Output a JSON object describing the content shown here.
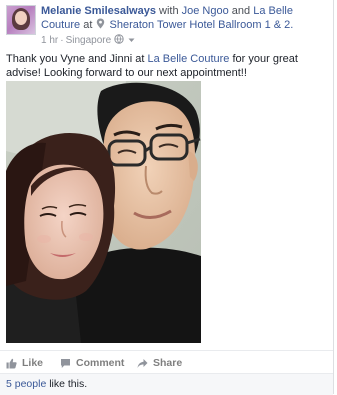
{
  "post": {
    "author": "Melanie Smilesalways",
    "with_text": "with",
    "tagged_1": "Joe Ngoo",
    "and_text": "and",
    "tagged_2": "La Belle Couture",
    "at_text": "at",
    "location": "Sheraton Tower Hotel Ballroom 1 & 2.",
    "time": "1 hr",
    "place": "Singapore",
    "message_part1": "Thank you Vyne and Jinni at",
    "message_link": "La Belle Couture",
    "message_part2": "for your great advise! Looking forward to our next appointment!!"
  },
  "actions": {
    "like_label": "Like",
    "comment_label": "Comment",
    "share_label": "Share"
  },
  "likes": {
    "count_link": "5 people",
    "suffix": "like this."
  },
  "icons": {
    "location": "map-pin-icon",
    "privacy": "globe-icon",
    "audience_menu": "chevron-down-icon",
    "like": "thumbs-up-icon",
    "comment": "comment-bubble-icon",
    "share": "share-arrow-icon"
  },
  "colors": {
    "link": "#3b5998",
    "meta": "#90949c",
    "action": "#7f7f7f",
    "footer_bg": "#f6f7f9"
  }
}
